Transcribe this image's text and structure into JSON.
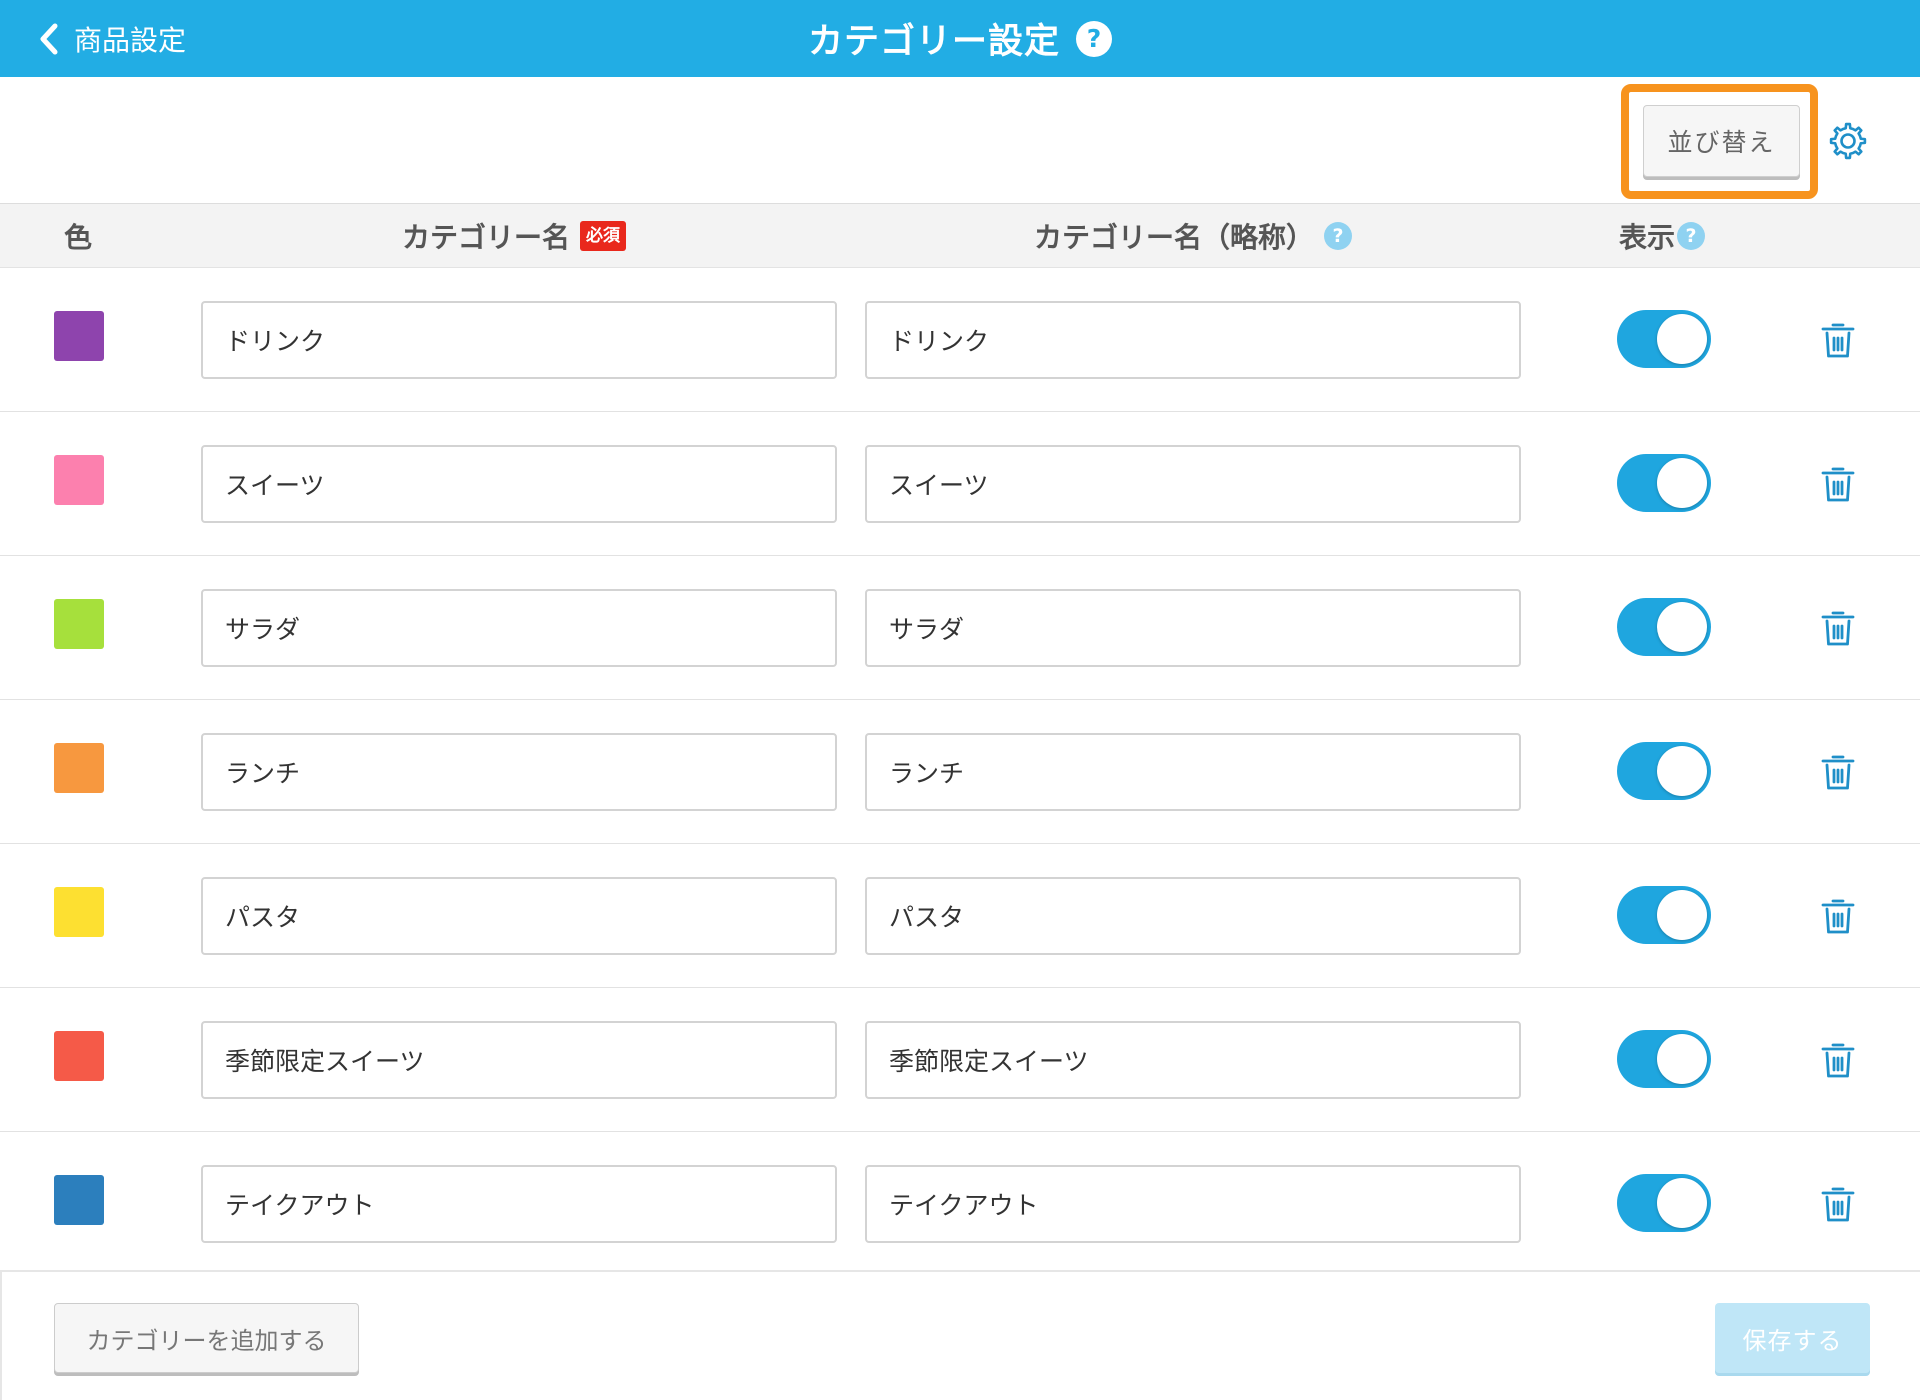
{
  "header": {
    "back_label": "商品設定",
    "title": "カテゴリー設定",
    "help_glyph": "?",
    "background": "#22ade4"
  },
  "toolbar": {
    "sort_label": "並び替え",
    "highlight_color": "#f7931e",
    "settings_icon": "gear-icon"
  },
  "columns": {
    "color": "色",
    "name": "カテゴリー名",
    "required": "必須",
    "short_name": "カテゴリー名（略称）",
    "visible": "表示",
    "help_glyph": "?"
  },
  "rows": [
    {
      "color": "#8e44ad",
      "name": "ドリンク",
      "short_name": "ドリンク",
      "visible": true
    },
    {
      "color": "#fc80ae",
      "name": "スイーツ",
      "short_name": "スイーツ",
      "visible": true
    },
    {
      "color": "#a6e03c",
      "name": "サラダ",
      "short_name": "サラダ",
      "visible": true
    },
    {
      "color": "#f7983f",
      "name": "ランチ",
      "short_name": "ランチ",
      "visible": true
    },
    {
      "color": "#fde031",
      "name": "パスタ",
      "short_name": "パスタ",
      "visible": true
    },
    {
      "color": "#f55a48",
      "name": "季節限定スイーツ",
      "short_name": "季節限定スイーツ",
      "visible": true
    },
    {
      "color": "#2c7fbd",
      "name": "テイクアウト",
      "short_name": "テイクアウト",
      "visible": true
    }
  ],
  "footer": {
    "add_label": "カテゴリーを追加する",
    "save_label": "保存する",
    "save_enabled": false
  },
  "colors": {
    "accent": "#22ade4",
    "toggle_on": "#1fa6df",
    "required_badge": "#e9281c",
    "trash_icon": "#1f8fc8"
  }
}
